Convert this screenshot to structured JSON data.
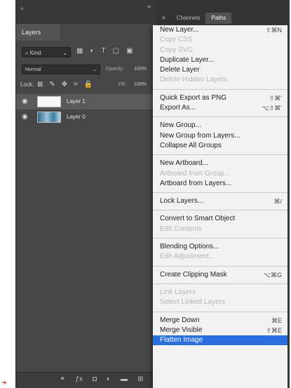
{
  "layers_panel": {
    "title": "Layers",
    "kind_filter": "Kind",
    "blend_mode": "Normal",
    "opacity_label": "Opacity:",
    "opacity_value": "100%",
    "lock_label": "Lock:",
    "fill_label": "Fill:",
    "fill_value": "100%",
    "layers": [
      {
        "name": "Layer 1",
        "selected": true
      },
      {
        "name": "Layer 0",
        "selected": false
      }
    ]
  },
  "right_panel": {
    "tabs": [
      "Channels",
      "Paths"
    ]
  },
  "menu": {
    "groups": [
      [
        {
          "label": "New Layer...",
          "shortcut": "⇧⌘N",
          "enabled": true
        },
        {
          "label": "Copy CSS",
          "shortcut": "",
          "enabled": false
        },
        {
          "label": "Copy SVG",
          "shortcut": "",
          "enabled": false
        },
        {
          "label": "Duplicate Layer...",
          "shortcut": "",
          "enabled": true
        },
        {
          "label": "Delete Layer",
          "shortcut": "",
          "enabled": true
        },
        {
          "label": "Delete Hidden Layers",
          "shortcut": "",
          "enabled": false
        }
      ],
      [
        {
          "label": "Quick Export as PNG",
          "shortcut": "⇧⌘'",
          "enabled": true
        },
        {
          "label": "Export As...",
          "shortcut": "⌥⇧⌘'",
          "enabled": true
        }
      ],
      [
        {
          "label": "New Group...",
          "shortcut": "",
          "enabled": true
        },
        {
          "label": "New Group from Layers...",
          "shortcut": "",
          "enabled": true
        },
        {
          "label": "Collapse All Groups",
          "shortcut": "",
          "enabled": true
        }
      ],
      [
        {
          "label": "New Artboard...",
          "shortcut": "",
          "enabled": true
        },
        {
          "label": "Artboard from Group...",
          "shortcut": "",
          "enabled": false
        },
        {
          "label": "Artboard from Layers...",
          "shortcut": "",
          "enabled": true
        }
      ],
      [
        {
          "label": "Lock Layers...",
          "shortcut": "⌘/",
          "enabled": true
        }
      ],
      [
        {
          "label": "Convert to Smart Object",
          "shortcut": "",
          "enabled": true
        },
        {
          "label": "Edit Contents",
          "shortcut": "",
          "enabled": false
        }
      ],
      [
        {
          "label": "Blending Options...",
          "shortcut": "",
          "enabled": true
        },
        {
          "label": "Edit Adjustment...",
          "shortcut": "",
          "enabled": false
        }
      ],
      [
        {
          "label": "Create Clipping Mask",
          "shortcut": "⌥⌘G",
          "enabled": true
        }
      ],
      [
        {
          "label": "Link Layers",
          "shortcut": "",
          "enabled": false
        },
        {
          "label": "Select Linked Layers",
          "shortcut": "",
          "enabled": false
        }
      ],
      [
        {
          "label": "Merge Down",
          "shortcut": "⌘E",
          "enabled": true
        },
        {
          "label": "Merge Visible",
          "shortcut": "⇧⌘E",
          "enabled": true
        },
        {
          "label": "Flatten Image",
          "shortcut": "",
          "enabled": true,
          "highlight": true
        }
      ]
    ]
  },
  "colors": {
    "panel_bg": "#464646",
    "menu_bg": "#f2f2f2",
    "highlight": "#2a6fe0"
  },
  "icons": {
    "eye": "eye-icon",
    "collapse": "double-chevron-icon"
  }
}
